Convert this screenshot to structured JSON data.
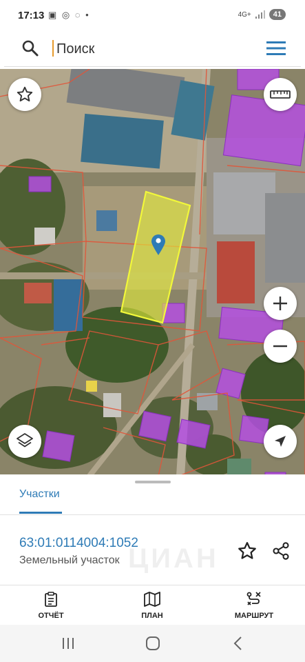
{
  "status_bar": {
    "time": "17:13",
    "left_icons": "▣ ◎ ◌ •",
    "network": "4G+",
    "battery": "41"
  },
  "search": {
    "placeholder": "Поиск"
  },
  "bottom_sheet": {
    "tab_label": "Участки",
    "parcel_id": "63:01:0114004:1052",
    "parcel_type": "Земельный участок",
    "watermark": "ЦИАН"
  },
  "actions": {
    "report_label": "ОТЧЁТ",
    "plan_label": "ПЛАН",
    "route_label": "МАРШРУТ"
  },
  "colors": {
    "accent": "#2e7bb6",
    "parcel_highlight": "#e4ef3a",
    "building_overlay": "#b44fe0",
    "boundary_lines": "#e0553a",
    "cursor": "#e69a2c"
  }
}
